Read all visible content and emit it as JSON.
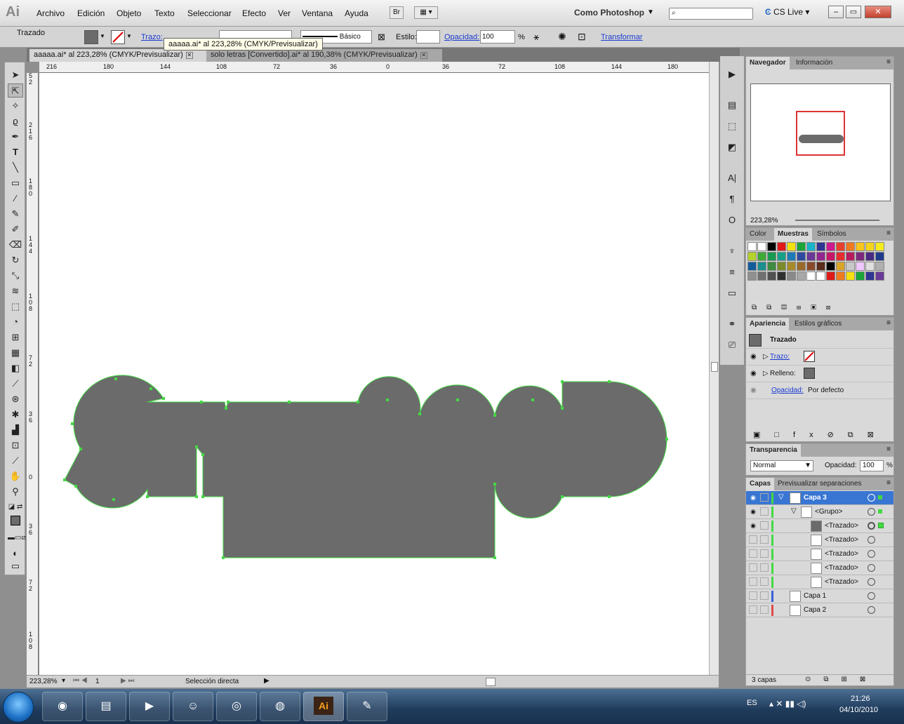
{
  "app": {
    "logo": "Ai",
    "bridge": "Br",
    "workspace": "Como Photoshop",
    "cslive": "CS Live"
  },
  "menu": [
    "Archivo",
    "Edición",
    "Objeto",
    "Texto",
    "Seleccionar",
    "Efecto",
    "Ver",
    "Ventana",
    "Ayuda"
  ],
  "control": {
    "object_type": "Trazado",
    "stroke_label": "Trazo:",
    "brush_label": "Básico",
    "style_label": "Estilo:",
    "opacity_label": "Opacidad:",
    "opacity_value": "100",
    "percent": "%",
    "transform_label": "Transformar"
  },
  "tooltip": "aaaaa.ai* al 223,28% (CMYK/Previsualizar)",
  "tabs": [
    {
      "label": "aaaaa.ai* al 223,28% (CMYK/Previsualizar)"
    },
    {
      "label": "solo letras [Convertido].ai* al 190,38% (CMYK/Previsualizar)"
    }
  ],
  "ruler_h": [
    "216",
    "180",
    "144",
    "108",
    "72",
    "36",
    "0",
    "36",
    "72",
    "108",
    "144",
    "180"
  ],
  "ruler_v": [
    "5 2",
    "2 1 6",
    "1 8 0",
    "1 4 4",
    "1 0 8",
    "7 2",
    "3 6",
    "0",
    "3 6",
    "7 2",
    "1 0 8"
  ],
  "status": {
    "zoom": "223,28%",
    "page": "1",
    "tool": "Selección directa"
  },
  "navigator": {
    "tabs": [
      "Navegador",
      "Información"
    ],
    "zoom": "223,28%"
  },
  "swatches_panel": {
    "tabs": [
      "Color",
      "Muestras",
      "Símbolos"
    ]
  },
  "appearance": {
    "tabs": [
      "Apariencia",
      "Estilos gráficos"
    ],
    "title": "Trazado",
    "stroke": "Trazo:",
    "fill": "Relleno:",
    "opacity": "Opacidad:",
    "opacity_value": "Por defecto"
  },
  "transparency": {
    "tab": "Transparencia",
    "mode": "Normal",
    "opacity_label": "Opacidad:",
    "opacity_value": "100",
    "percent": "%"
  },
  "layers": {
    "tabs": [
      "Capas",
      "Previsualizar separaciones"
    ],
    "rows": [
      {
        "name": "Capa 3"
      },
      {
        "name": "<Grupo>"
      },
      {
        "name": "<Trazado>"
      },
      {
        "name": "<Trazado>"
      },
      {
        "name": "<Trazado>"
      },
      {
        "name": "<Trazado>"
      },
      {
        "name": "<Trazado>"
      },
      {
        "name": "Capa 1"
      },
      {
        "name": "Capa 2"
      }
    ],
    "count": "3 capas"
  },
  "taskbar": {
    "lang": "ES",
    "time": "21:26",
    "date": "04/10/2010"
  },
  "colors": {
    "artwork": "#6b6b6b",
    "selection": "#43d943",
    "layer_selected": "#3976d3"
  }
}
